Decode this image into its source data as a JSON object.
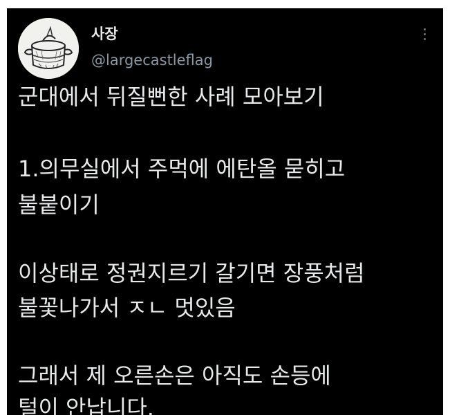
{
  "author": {
    "display_name": "사장",
    "handle": "@largecastleflag"
  },
  "tweet": {
    "lines": [
      "군대에서 뒤질뻔한 사례 모아보기",
      "1.의무실에서 주먹에 에탄올 묻히고",
      "불붙이기",
      "이상태로 정권지르기 갈기면 장풍처럼",
      "불꽃나가서 ㅈㄴ 멋있음",
      "그래서 제 오른손은 아직도 손등에",
      "털이 안납니다."
    ]
  },
  "icons": {
    "avatar": "pot-drawing-avatar",
    "more": "more-options-icon"
  },
  "colors": {
    "background": "#000000",
    "text": "#e7e9ea",
    "secondary": "#8b98a5"
  }
}
